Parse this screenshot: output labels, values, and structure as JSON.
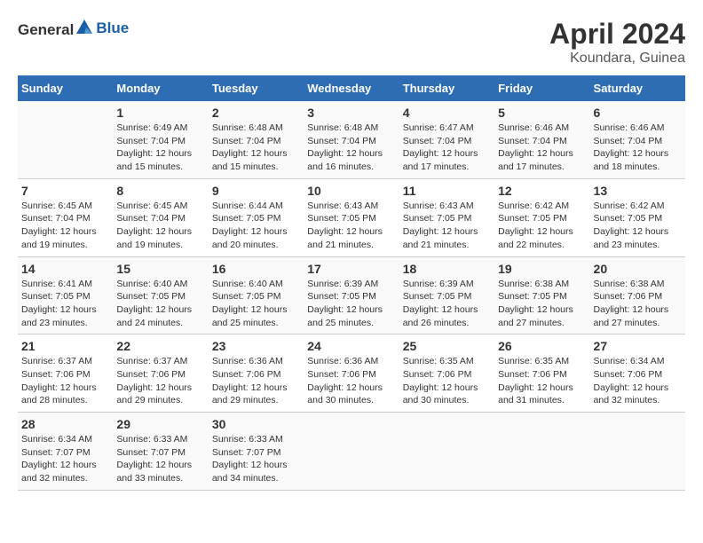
{
  "logo": {
    "general": "General",
    "blue": "Blue"
  },
  "title": "April 2024",
  "subtitle": "Koundara, Guinea",
  "days_of_week": [
    "Sunday",
    "Monday",
    "Tuesday",
    "Wednesday",
    "Thursday",
    "Friday",
    "Saturday"
  ],
  "weeks": [
    [
      {
        "day": "",
        "sunrise": "",
        "sunset": "",
        "daylight": ""
      },
      {
        "day": "1",
        "sunrise": "Sunrise: 6:49 AM",
        "sunset": "Sunset: 7:04 PM",
        "daylight": "Daylight: 12 hours and 15 minutes."
      },
      {
        "day": "2",
        "sunrise": "Sunrise: 6:48 AM",
        "sunset": "Sunset: 7:04 PM",
        "daylight": "Daylight: 12 hours and 15 minutes."
      },
      {
        "day": "3",
        "sunrise": "Sunrise: 6:48 AM",
        "sunset": "Sunset: 7:04 PM",
        "daylight": "Daylight: 12 hours and 16 minutes."
      },
      {
        "day": "4",
        "sunrise": "Sunrise: 6:47 AM",
        "sunset": "Sunset: 7:04 PM",
        "daylight": "Daylight: 12 hours and 17 minutes."
      },
      {
        "day": "5",
        "sunrise": "Sunrise: 6:46 AM",
        "sunset": "Sunset: 7:04 PM",
        "daylight": "Daylight: 12 hours and 17 minutes."
      },
      {
        "day": "6",
        "sunrise": "Sunrise: 6:46 AM",
        "sunset": "Sunset: 7:04 PM",
        "daylight": "Daylight: 12 hours and 18 minutes."
      }
    ],
    [
      {
        "day": "7",
        "sunrise": "Sunrise: 6:45 AM",
        "sunset": "Sunset: 7:04 PM",
        "daylight": "Daylight: 12 hours and 19 minutes."
      },
      {
        "day": "8",
        "sunrise": "Sunrise: 6:45 AM",
        "sunset": "Sunset: 7:04 PM",
        "daylight": "Daylight: 12 hours and 19 minutes."
      },
      {
        "day": "9",
        "sunrise": "Sunrise: 6:44 AM",
        "sunset": "Sunset: 7:05 PM",
        "daylight": "Daylight: 12 hours and 20 minutes."
      },
      {
        "day": "10",
        "sunrise": "Sunrise: 6:43 AM",
        "sunset": "Sunset: 7:05 PM",
        "daylight": "Daylight: 12 hours and 21 minutes."
      },
      {
        "day": "11",
        "sunrise": "Sunrise: 6:43 AM",
        "sunset": "Sunset: 7:05 PM",
        "daylight": "Daylight: 12 hours and 21 minutes."
      },
      {
        "day": "12",
        "sunrise": "Sunrise: 6:42 AM",
        "sunset": "Sunset: 7:05 PM",
        "daylight": "Daylight: 12 hours and 22 minutes."
      },
      {
        "day": "13",
        "sunrise": "Sunrise: 6:42 AM",
        "sunset": "Sunset: 7:05 PM",
        "daylight": "Daylight: 12 hours and 23 minutes."
      }
    ],
    [
      {
        "day": "14",
        "sunrise": "Sunrise: 6:41 AM",
        "sunset": "Sunset: 7:05 PM",
        "daylight": "Daylight: 12 hours and 23 minutes."
      },
      {
        "day": "15",
        "sunrise": "Sunrise: 6:40 AM",
        "sunset": "Sunset: 7:05 PM",
        "daylight": "Daylight: 12 hours and 24 minutes."
      },
      {
        "day": "16",
        "sunrise": "Sunrise: 6:40 AM",
        "sunset": "Sunset: 7:05 PM",
        "daylight": "Daylight: 12 hours and 25 minutes."
      },
      {
        "day": "17",
        "sunrise": "Sunrise: 6:39 AM",
        "sunset": "Sunset: 7:05 PM",
        "daylight": "Daylight: 12 hours and 25 minutes."
      },
      {
        "day": "18",
        "sunrise": "Sunrise: 6:39 AM",
        "sunset": "Sunset: 7:05 PM",
        "daylight": "Daylight: 12 hours and 26 minutes."
      },
      {
        "day": "19",
        "sunrise": "Sunrise: 6:38 AM",
        "sunset": "Sunset: 7:05 PM",
        "daylight": "Daylight: 12 hours and 27 minutes."
      },
      {
        "day": "20",
        "sunrise": "Sunrise: 6:38 AM",
        "sunset": "Sunset: 7:06 PM",
        "daylight": "Daylight: 12 hours and 27 minutes."
      }
    ],
    [
      {
        "day": "21",
        "sunrise": "Sunrise: 6:37 AM",
        "sunset": "Sunset: 7:06 PM",
        "daylight": "Daylight: 12 hours and 28 minutes."
      },
      {
        "day": "22",
        "sunrise": "Sunrise: 6:37 AM",
        "sunset": "Sunset: 7:06 PM",
        "daylight": "Daylight: 12 hours and 29 minutes."
      },
      {
        "day": "23",
        "sunrise": "Sunrise: 6:36 AM",
        "sunset": "Sunset: 7:06 PM",
        "daylight": "Daylight: 12 hours and 29 minutes."
      },
      {
        "day": "24",
        "sunrise": "Sunrise: 6:36 AM",
        "sunset": "Sunset: 7:06 PM",
        "daylight": "Daylight: 12 hours and 30 minutes."
      },
      {
        "day": "25",
        "sunrise": "Sunrise: 6:35 AM",
        "sunset": "Sunset: 7:06 PM",
        "daylight": "Daylight: 12 hours and 30 minutes."
      },
      {
        "day": "26",
        "sunrise": "Sunrise: 6:35 AM",
        "sunset": "Sunset: 7:06 PM",
        "daylight": "Daylight: 12 hours and 31 minutes."
      },
      {
        "day": "27",
        "sunrise": "Sunrise: 6:34 AM",
        "sunset": "Sunset: 7:06 PM",
        "daylight": "Daylight: 12 hours and 32 minutes."
      }
    ],
    [
      {
        "day": "28",
        "sunrise": "Sunrise: 6:34 AM",
        "sunset": "Sunset: 7:07 PM",
        "daylight": "Daylight: 12 hours and 32 minutes."
      },
      {
        "day": "29",
        "sunrise": "Sunrise: 6:33 AM",
        "sunset": "Sunset: 7:07 PM",
        "daylight": "Daylight: 12 hours and 33 minutes."
      },
      {
        "day": "30",
        "sunrise": "Sunrise: 6:33 AM",
        "sunset": "Sunset: 7:07 PM",
        "daylight": "Daylight: 12 hours and 34 minutes."
      },
      {
        "day": "",
        "sunrise": "",
        "sunset": "",
        "daylight": ""
      },
      {
        "day": "",
        "sunrise": "",
        "sunset": "",
        "daylight": ""
      },
      {
        "day": "",
        "sunrise": "",
        "sunset": "",
        "daylight": ""
      },
      {
        "day": "",
        "sunrise": "",
        "sunset": "",
        "daylight": ""
      }
    ]
  ]
}
